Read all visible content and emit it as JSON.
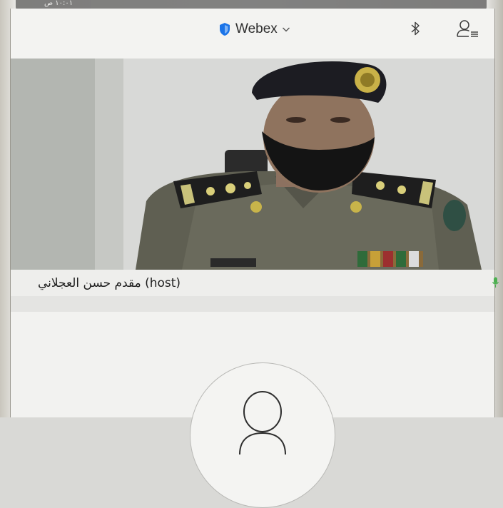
{
  "status_bar": {
    "time": "١٠:٠١ ص"
  },
  "header": {
    "brand_label": "Webex",
    "brand_icon": "shield-icon",
    "dropdown_icon": "chevron-down-icon",
    "bluetooth_icon": "bluetooth-icon",
    "participants_icon": "participants-icon"
  },
  "video": {
    "participant_name": "مقدم حسن العجلاني (host)",
    "mic_icon": "microphone-icon",
    "mic_color": "#4caf50"
  },
  "self_view": {
    "avatar_icon": "avatar-placeholder-icon"
  },
  "colors": {
    "brand_blue": "#1a73e8",
    "background": "#f1f1ef"
  }
}
